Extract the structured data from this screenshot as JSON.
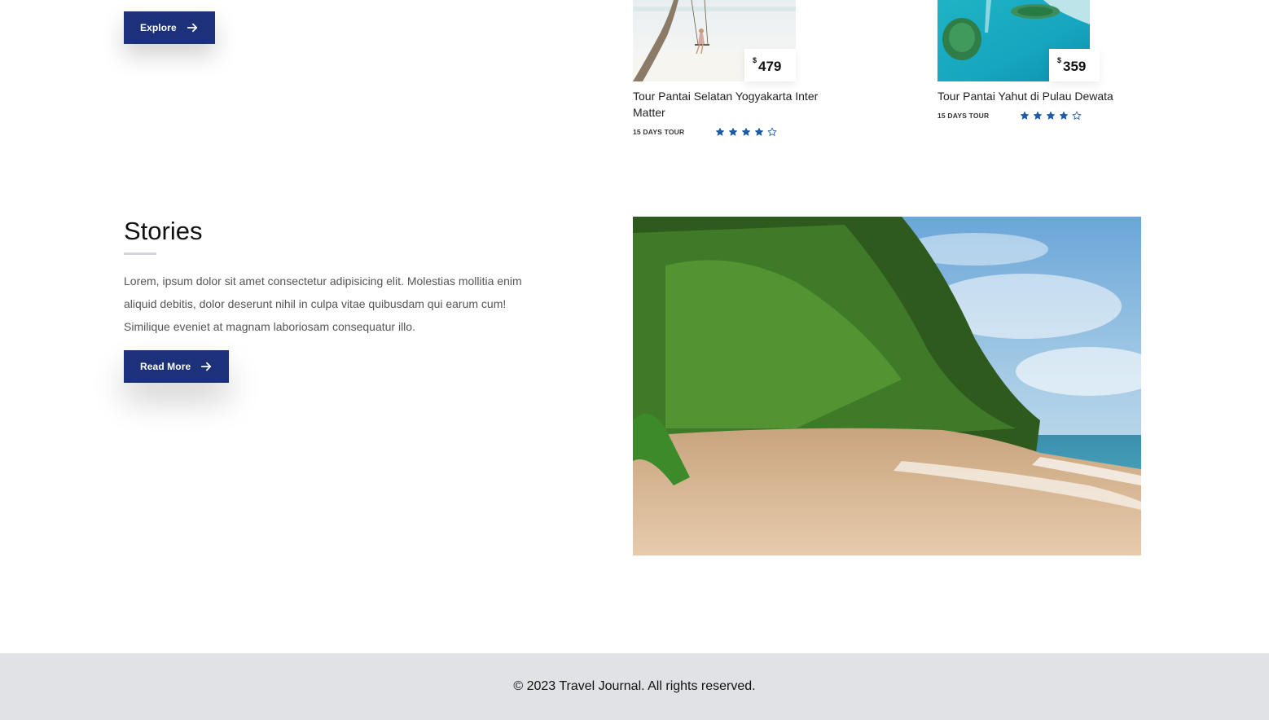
{
  "hero": {
    "explore_label": "Explore",
    "arrow_icon": "arrow-right-icon"
  },
  "tours": [
    {
      "title": "Tour Pantai Selatan Yogyakarta Inter Matter",
      "currency": "$",
      "price": "479",
      "duration": "15 DAYS TOUR",
      "rating": 4,
      "max_rating": 5
    },
    {
      "title": "Tour Pantai Yahut di Pulau Dewata",
      "currency": "$",
      "price": "359",
      "duration": "15 DAYS TOUR",
      "rating": 4,
      "max_rating": 5
    }
  ],
  "stories": {
    "title": "Stories",
    "body": "Lorem, ipsum dolor sit amet consectetur adipisicing elit. Molestias mollitia enim aliquid debitis, dolor deserunt nihil in culpa vitae quibusdam qui earum cum! Similique eveniet at magnam laboriosam consequatur illo.",
    "read_more_label": "Read More"
  },
  "footer": {
    "copyright": "© 2023 Travel Journal. All rights reserved."
  },
  "colors": {
    "primary": "#1c3179",
    "star": "#1c5aa5",
    "footer_bg": "#e1e2e6"
  }
}
